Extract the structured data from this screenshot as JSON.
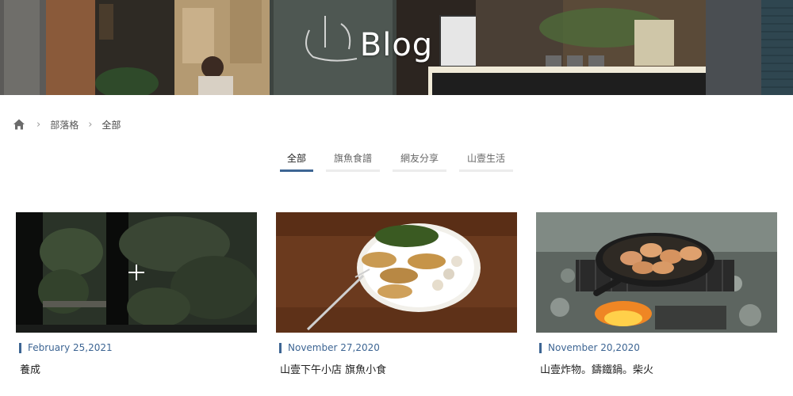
{
  "hero": {
    "title": "Blog"
  },
  "breadcrumb": {
    "items": [
      {
        "label": "部落格"
      },
      {
        "label": "全部"
      }
    ]
  },
  "tabs": [
    {
      "label": "全部",
      "active": true
    },
    {
      "label": "旗魚食譜",
      "active": false
    },
    {
      "label": "網友分享",
      "active": false
    },
    {
      "label": "山壹生活",
      "active": false
    }
  ],
  "posts": [
    {
      "date": "February 25,2021",
      "title": "養成"
    },
    {
      "date": "November 27,2020",
      "title": "山壹下午小店 旗魚小食"
    },
    {
      "date": "November 20,2020",
      "title": "山壹炸物。鑄鐵鍋。柴火"
    }
  ],
  "colors": {
    "accent": "#3d6593",
    "tab_underline_inactive": "#ececec"
  }
}
